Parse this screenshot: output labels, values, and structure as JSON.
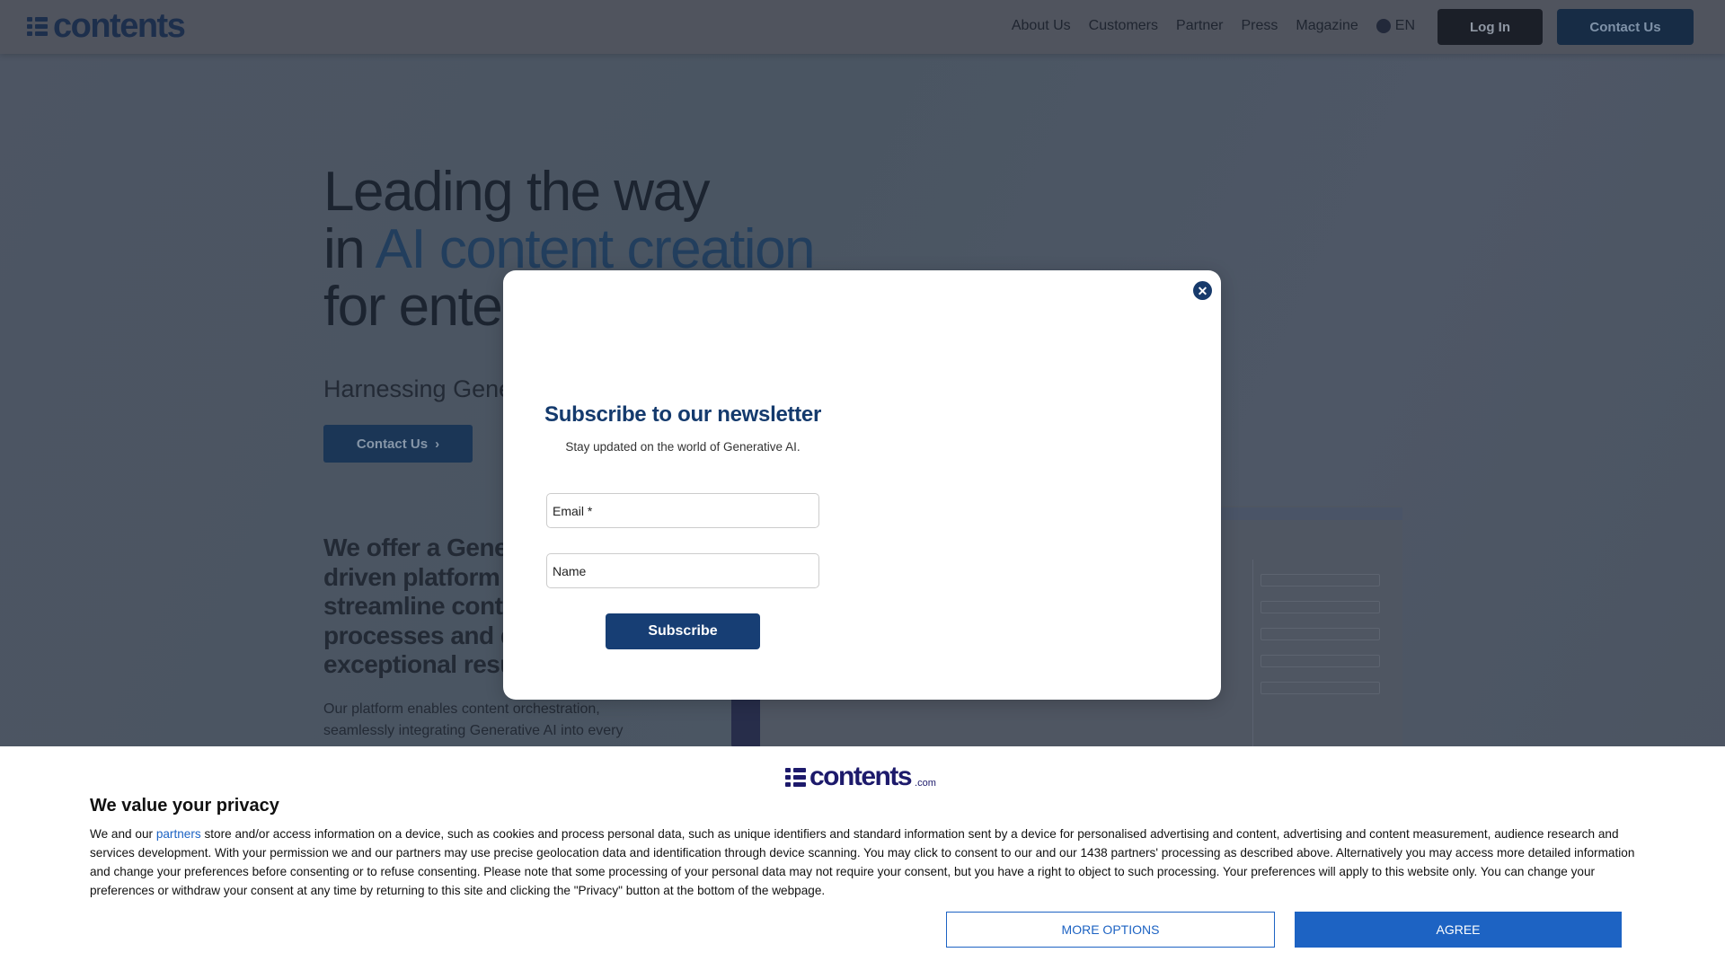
{
  "nav": {
    "logo": "contents",
    "links": [
      "About Us",
      "Customers",
      "Partner",
      "Press",
      "Magazine"
    ],
    "lang": "EN",
    "login": "Log In",
    "contact": "Contact Us"
  },
  "hero": {
    "line1": "Leading the way",
    "line2_pre": "in ",
    "line2_ai": "AI content creation",
    "line3": "for ente",
    "subtitle": "Harnessing Gene",
    "button": "Contact Us",
    "button_icon": "chevron-right-icon",
    "offer": [
      "We offer a Gene",
      "driven platform",
      "streamline conte",
      "processes and d",
      "exceptional resu"
    ],
    "paragraph": [
      "Our platform enables content orchestration,",
      "seamlessly integrating Generative AI into every"
    ]
  },
  "modal": {
    "title": "Subscribe to our newsletter",
    "subtitle": "Stay updated on the world of Generative AI.",
    "email_label": "Email *",
    "name_label": "Name",
    "subscribe": "Subscribe",
    "close_icon": "close-circle-icon"
  },
  "cookie": {
    "logo": "contents",
    "logo_suffix": ".com",
    "title": "We value your privacy",
    "text_pre": "We and our ",
    "partners_link": "partners",
    "text_post": " store and/or access information on a device, such as cookies and process personal data, such as unique identifiers and standard information sent by a device for personalised advertising and content, advertising and content measurement, audience research and services development. With your permission we and our partners may use precise geolocation data and identification through device scanning. You may click to consent to our and our 1438 partners' processing as described above. Alternatively you may access more detailed information and change your preferences before consenting or to refuse consenting. Please note that some processing of your personal data may not require your consent, but you have a right to object to such processing. Your preferences will apply to this website only. You can change your preferences or withdraw your consent at any time by returning to this site and clicking the \"Privacy\" button at the bottom of the webpage.",
    "more_options": "MORE OPTIONS",
    "agree": "AGREE"
  },
  "colors": {
    "brand_navy": "#143a6d",
    "agree_blue": "#1d63c3"
  }
}
